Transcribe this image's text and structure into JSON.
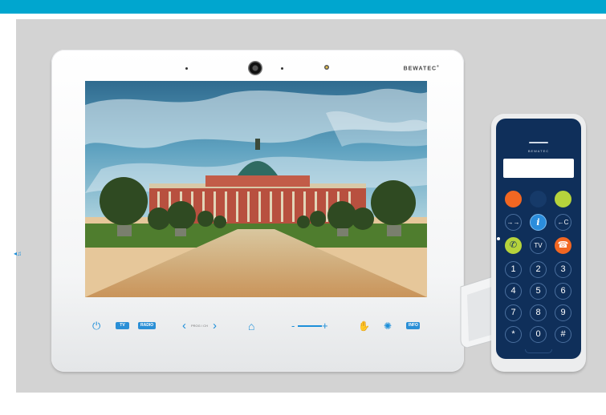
{
  "colors": {
    "top_bar": "#00a6cf",
    "backdrop": "#d3d3d3",
    "terminal_body": "#f4f5f6",
    "control_icon_blue": "#1d8fd9",
    "handset_face": "#0f2f5a",
    "key_orange": "#f26722",
    "key_green": "#b6d33c"
  },
  "terminal": {
    "brand": "BEWATEC",
    "brand_mark": "®",
    "screen_image": "palace-with-trees-and-blue-sky",
    "controls": {
      "power_icon": "power-icon",
      "tv_label": "TV",
      "radio_label": "RADIO",
      "channel_left_icon": "chevron-left-icon",
      "channel_label": "PROG / CH",
      "channel_right_icon": "chevron-right-icon",
      "home_icon": "home-icon",
      "volume_minus": "-",
      "volume_plus": "+",
      "nurse_call_icon": "nurse-call-icon",
      "light_icon": "light-icon",
      "info_label": "INFO"
    },
    "headphone_icon": "headphone-jack-icon"
  },
  "handset": {
    "brand": "BEWATEC",
    "keys": {
      "row1": [
        "",
        "",
        ""
      ],
      "row2": [
        "→→",
        "i",
        "←C"
      ],
      "row3": [
        "",
        "TV",
        ""
      ],
      "digits": [
        "1",
        "2",
        "3",
        "4",
        "5",
        "6",
        "7",
        "8",
        "9",
        "*",
        "0",
        "#"
      ]
    },
    "call_icon": "phone-accept-icon",
    "hangup_icon": "phone-hangup-icon"
  }
}
